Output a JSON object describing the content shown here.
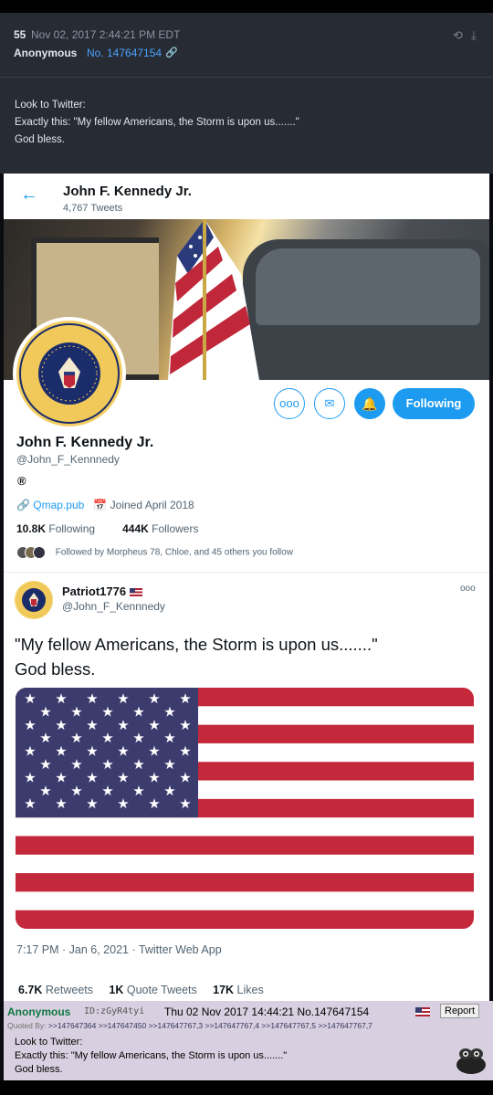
{
  "qpost": {
    "number": "55",
    "date": "Nov 02, 2017 2:44:21 PM EDT",
    "author": "Anonymous",
    "post_id": "No. 147647154",
    "body": [
      "Look to Twitter:",
      "Exactly this: \"My fellow Americans, the Storm is upon us.......\"",
      "God bless."
    ],
    "icons": [
      "link-icon",
      "share-icon",
      "download-icon"
    ]
  },
  "twitter": {
    "header": {
      "name": "John F. Kennedy Jr.",
      "tweet_count": "4,767 Tweets"
    },
    "profile": {
      "name": "John F. Kennedy Jr.",
      "handle": "@John_F_Kennnedy",
      "badge": "®",
      "link": "Qmap.pub",
      "joined": "Joined April 2018",
      "following_count": "10.8K",
      "following_label": "Following",
      "followers_count": "444K",
      "followers_label": "Followers",
      "followed_by": "Followed by Morpheus 78, Chloe, and 45 others you follow",
      "follow_button": "Following",
      "more_glyph": "ooo"
    },
    "seal": {
      "top": "DONALD TRUMP",
      "right": "PRESIDENT",
      "left": "STATES",
      "bottom": "OF THE UNITED"
    },
    "tweet": {
      "name": "Patriot1776",
      "handle": "@John_F_Kennnedy",
      "more": "ooo",
      "text_line1": "\"My fellow Americans, the Storm is upon us.......\"",
      "text_line2": "God bless.",
      "timestamp": "7:17 PM · Jan 6, 2021 · Twitter Web App",
      "retweets_count": "6.7K",
      "retweets_label": "Retweets",
      "quotes_count": "1K",
      "quotes_label": "Quote Tweets",
      "likes_count": "17K",
      "likes_label": "Likes"
    }
  },
  "chan": {
    "author": "Anonymous",
    "id": "ID:zGyR4tyi",
    "date": "Thu 02 Nov 2017 14:44:21 No.147647154",
    "report": "Report",
    "quoted_label": "Quoted By:",
    "quoted_links": ">>147647364 >>147647450 >>147647767,3 >>147647767,4 >>147647767,5 >>147647767,7",
    "body": [
      "Look to Twitter:",
      "Exactly this: \"My fellow Americans, the Storm is upon us.......\"",
      "God bless."
    ]
  },
  "colors": {
    "twitter_blue": "#1d9bf0",
    "chan_green": "#117743",
    "chan_bg": "#d8d0e0",
    "q_bg": "#272b33"
  }
}
